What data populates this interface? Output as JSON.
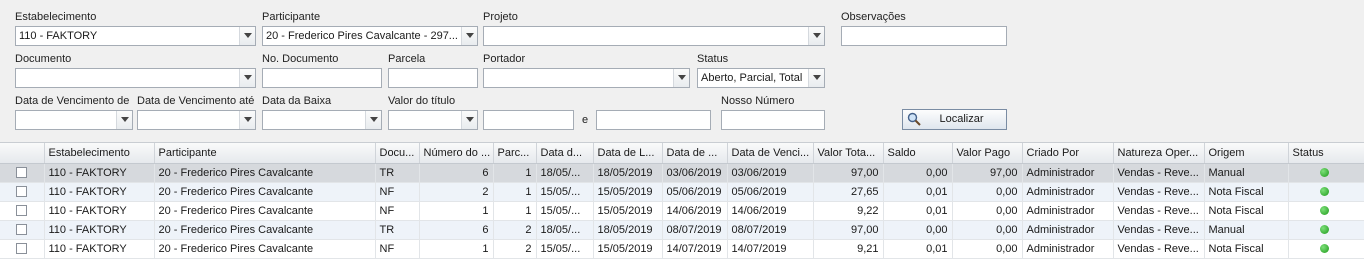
{
  "filters": {
    "estabelecimento": {
      "label": "Estabelecimento",
      "value": "110 - FAKTORY"
    },
    "participante": {
      "label": "Participante",
      "value": "20 - Frederico Pires Cavalcante - 297..."
    },
    "projeto": {
      "label": "Projeto",
      "value": ""
    },
    "observacoes": {
      "label": "Observações",
      "value": ""
    },
    "documento": {
      "label": "Documento",
      "value": ""
    },
    "no_documento": {
      "label": "No. Documento",
      "value": ""
    },
    "parcela": {
      "label": "Parcela",
      "value": ""
    },
    "portador": {
      "label": "Portador",
      "value": ""
    },
    "status": {
      "label": "Status",
      "value": "Aberto, Parcial, Total"
    },
    "venc_de": {
      "label": "Data de Vencimento de",
      "value": ""
    },
    "venc_ate": {
      "label": "Data de Vencimento até",
      "value": ""
    },
    "data_baixa": {
      "label": "Data da Baixa",
      "value": ""
    },
    "valor_titulo": {
      "label": "Valor do título",
      "value": "",
      "from": "",
      "to": "",
      "sep": "e"
    },
    "nosso_numero": {
      "label": "Nosso Número",
      "value": ""
    },
    "localizar_label": "Localizar"
  },
  "grid": {
    "columns": [
      "",
      "Estabelecimento",
      "Participante",
      "Docu...",
      "Número do ...",
      "Parc...",
      "Data d...",
      "Data de L...",
      "Data de ...",
      "Data de Venci...",
      "Valor Tota...",
      "Saldo",
      "Valor Pago",
      "Criado Por",
      "Natureza Oper...",
      "Origem",
      "Status"
    ],
    "rows": [
      [
        "110 - FAKTORY",
        "20 - Frederico Pires Cavalcante",
        "TR",
        "6",
        "1",
        "18/05/...",
        "18/05/2019",
        "03/06/2019",
        "03/06/2019",
        "97,00",
        "0,00",
        "97,00",
        "Administrador",
        "Vendas - Reve...",
        "Manual"
      ],
      [
        "110 - FAKTORY",
        "20 - Frederico Pires Cavalcante",
        "NF",
        "2",
        "1",
        "15/05/...",
        "15/05/2019",
        "05/06/2019",
        "05/06/2019",
        "27,65",
        "0,01",
        "0,00",
        "Administrador",
        "Vendas - Reve...",
        "Nota Fiscal"
      ],
      [
        "110 - FAKTORY",
        "20 - Frederico Pires Cavalcante",
        "NF",
        "1",
        "1",
        "15/05/...",
        "15/05/2019",
        "14/06/2019",
        "14/06/2019",
        "9,22",
        "0,01",
        "0,00",
        "Administrador",
        "Vendas - Reve...",
        "Nota Fiscal"
      ],
      [
        "110 - FAKTORY",
        "20 - Frederico Pires Cavalcante",
        "TR",
        "6",
        "2",
        "18/05/...",
        "18/05/2019",
        "08/07/2019",
        "08/07/2019",
        "97,00",
        "0,00",
        "0,00",
        "Administrador",
        "Vendas - Reve...",
        "Manual"
      ],
      [
        "110 - FAKTORY",
        "20 - Frederico Pires Cavalcante",
        "NF",
        "1",
        "2",
        "15/05/...",
        "15/05/2019",
        "14/07/2019",
        "14/07/2019",
        "9,21",
        "0,01",
        "0,00",
        "Administrador",
        "Vendas - Reve...",
        "Nota Fiscal"
      ]
    ],
    "status_color": "#22a31d"
  }
}
